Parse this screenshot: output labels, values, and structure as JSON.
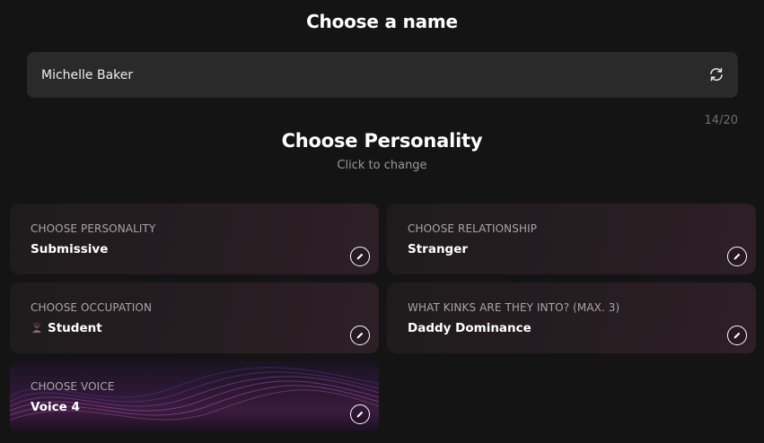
{
  "name_section": {
    "title": "Choose a name",
    "input_value": "Michelle Baker",
    "counter": "14/20",
    "refresh_icon": "refresh-icon"
  },
  "personality_section": {
    "title": "Choose Personality",
    "subtitle": "Click to change"
  },
  "cards": [
    {
      "label": "CHOOSE PERSONALITY",
      "value": "Submissive",
      "icon": "pencil-icon"
    },
    {
      "label": "CHOOSE RELATIONSHIP",
      "value": "Stranger",
      "icon": "pencil-icon"
    },
    {
      "label": "CHOOSE OCCUPATION",
      "value": "Student",
      "emoji": "student-emoji",
      "icon": "pencil-icon"
    },
    {
      "label": "WHAT KINKS ARE THEY INTO? (MAX. 3)",
      "value": "Daddy Dominance",
      "icon": "pencil-icon"
    },
    {
      "label": "CHOOSE VOICE",
      "value": "Voice 4",
      "icon": "pencil-icon"
    }
  ],
  "colors": {
    "background": "#141414",
    "input_bg": "#2a2a2a",
    "card_bg": "#241c20",
    "voice_card_bg": "#3a1b3e"
  }
}
